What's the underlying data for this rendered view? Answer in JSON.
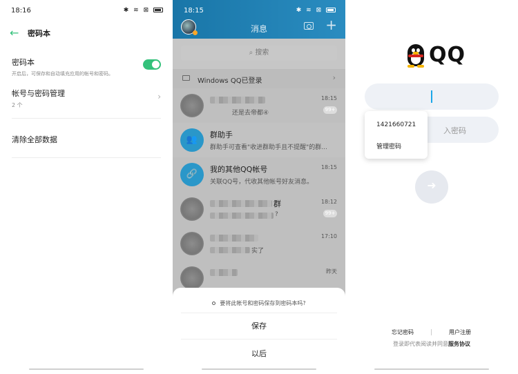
{
  "panel1": {
    "status": {
      "time": "18:16",
      "icons": "✱ ≋ ⊠"
    },
    "title": "密码本",
    "password_book": {
      "label": "密码本",
      "sub": "开启后，可保存和自动填充应用的帐号和密码。",
      "enabled": true
    },
    "account_mgmt": {
      "label": "帐号与密码管理",
      "sub": "2 个"
    },
    "clear_all": {
      "label": "清除全部数据"
    }
  },
  "panel2": {
    "status": {
      "time": "18:15",
      "icons": "✱ ≋ ⊠"
    },
    "header_title": "消息",
    "search_placeholder": "搜索",
    "device_bar": "Windows QQ已登录",
    "chats": [
      {
        "name": "",
        "msg": "还是去帝都④",
        "time": "18:15",
        "badge": "99+"
      },
      {
        "name": "群助手",
        "msg": "群助手可查看\"收进群助手且不提醒\"的群...",
        "time": "",
        "badge": ""
      },
      {
        "name": "我的其他QQ帐号",
        "msg": "关联QQ号，代收其他帐号好友消息。",
        "time": "18:15",
        "badge": ""
      },
      {
        "name": "群",
        "msg": "?",
        "time": "18:12",
        "badge": "99+"
      },
      {
        "name": "",
        "msg": "实了",
        "time": "17:10",
        "badge": ""
      },
      {
        "name": "",
        "msg": "",
        "time": "昨天",
        "badge": ""
      }
    ],
    "sheet": {
      "question": "要将此帐号和密码保存到密码本吗?",
      "save": "保存",
      "later": "以后"
    }
  },
  "panel3": {
    "logo_text": "QQ",
    "password_placeholder": "入密码",
    "popup": {
      "account": "1421660721",
      "manage": "管理密码"
    },
    "forgot": "忘记密码",
    "register": "用户注册",
    "agreement_prefix": "登录即代表阅读并同意",
    "agreement_link": "服务协议"
  }
}
